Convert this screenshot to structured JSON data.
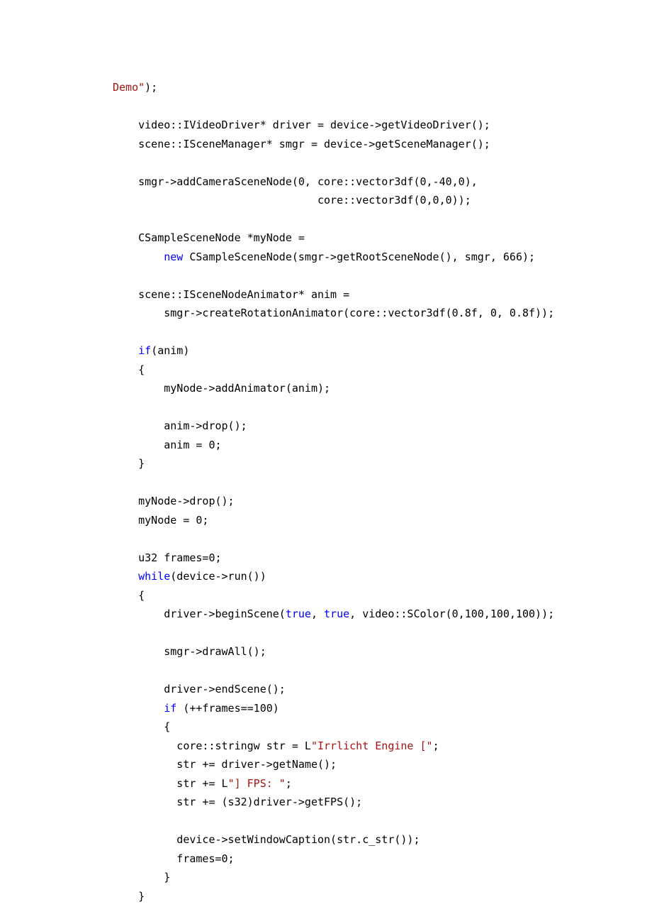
{
  "lines": [
    [
      {
        "t": "Demo\"",
        "c": "str"
      },
      {
        "t": ");",
        "c": ""
      }
    ],
    [],
    [
      {
        "t": "    video::IVideoDriver* driver = device->getVideoDriver();",
        "c": ""
      }
    ],
    [
      {
        "t": "    scene::ISceneManager* smgr = device->getSceneManager();",
        "c": ""
      }
    ],
    [],
    [
      {
        "t": "    smgr->addCameraSceneNode(0, core::vector3df(0,-40,0),",
        "c": ""
      }
    ],
    [
      {
        "t": "                                core::vector3df(0,0,0));",
        "c": ""
      }
    ],
    [],
    [
      {
        "t": "    CSampleSceneNode *myNode =",
        "c": ""
      }
    ],
    [
      {
        "t": "        ",
        "c": ""
      },
      {
        "t": "new",
        "c": "kw"
      },
      {
        "t": " CSampleSceneNode(smgr->getRootSceneNode(), smgr, 666);",
        "c": ""
      }
    ],
    [],
    [
      {
        "t": "    scene::ISceneNodeAnimator* anim =",
        "c": ""
      }
    ],
    [
      {
        "t": "        smgr->createRotationAnimator(core::vector3df(0.8f, 0, 0.8f));",
        "c": ""
      }
    ],
    [],
    [
      {
        "t": "    ",
        "c": ""
      },
      {
        "t": "if",
        "c": "kw"
      },
      {
        "t": "(anim)",
        "c": ""
      }
    ],
    [
      {
        "t": "    {",
        "c": ""
      }
    ],
    [
      {
        "t": "        myNode->addAnimator(anim);",
        "c": ""
      }
    ],
    [],
    [
      {
        "t": "        anim->drop();",
        "c": ""
      }
    ],
    [
      {
        "t": "        anim = 0;",
        "c": ""
      }
    ],
    [
      {
        "t": "    }",
        "c": ""
      }
    ],
    [],
    [
      {
        "t": "    myNode->drop();",
        "c": ""
      }
    ],
    [
      {
        "t": "    myNode = 0;",
        "c": ""
      }
    ],
    [],
    [
      {
        "t": "    u32 frames=0;",
        "c": ""
      }
    ],
    [
      {
        "t": "    ",
        "c": ""
      },
      {
        "t": "while",
        "c": "kw"
      },
      {
        "t": "(device->run())",
        "c": ""
      }
    ],
    [
      {
        "t": "    {",
        "c": ""
      }
    ],
    [
      {
        "t": "        driver->beginScene(",
        "c": ""
      },
      {
        "t": "true",
        "c": "kw"
      },
      {
        "t": ", ",
        "c": ""
      },
      {
        "t": "true",
        "c": "kw"
      },
      {
        "t": ", video::SColor(0,100,100,100));",
        "c": ""
      }
    ],
    [],
    [
      {
        "t": "        smgr->drawAll();",
        "c": ""
      }
    ],
    [],
    [
      {
        "t": "        driver->endScene();",
        "c": ""
      }
    ],
    [
      {
        "t": "        ",
        "c": ""
      },
      {
        "t": "if",
        "c": "kw"
      },
      {
        "t": " (++frames==100)",
        "c": ""
      }
    ],
    [
      {
        "t": "        {",
        "c": ""
      }
    ],
    [
      {
        "t": "          core::stringw str = L",
        "c": ""
      },
      {
        "t": "\"Irrlicht Engine [\"",
        "c": "str"
      },
      {
        "t": ";",
        "c": ""
      }
    ],
    [
      {
        "t": "          str += driver->getName();",
        "c": ""
      }
    ],
    [
      {
        "t": "          str += L",
        "c": ""
      },
      {
        "t": "\"] FPS: \"",
        "c": "str"
      },
      {
        "t": ";",
        "c": ""
      }
    ],
    [
      {
        "t": "          str += (s32)driver->getFPS();",
        "c": ""
      }
    ],
    [],
    [
      {
        "t": "          device->setWindowCaption(str.c_str());",
        "c": ""
      }
    ],
    [
      {
        "t": "          frames=0;",
        "c": ""
      }
    ],
    [
      {
        "t": "        }",
        "c": ""
      }
    ],
    [
      {
        "t": "    }",
        "c": ""
      }
    ]
  ]
}
